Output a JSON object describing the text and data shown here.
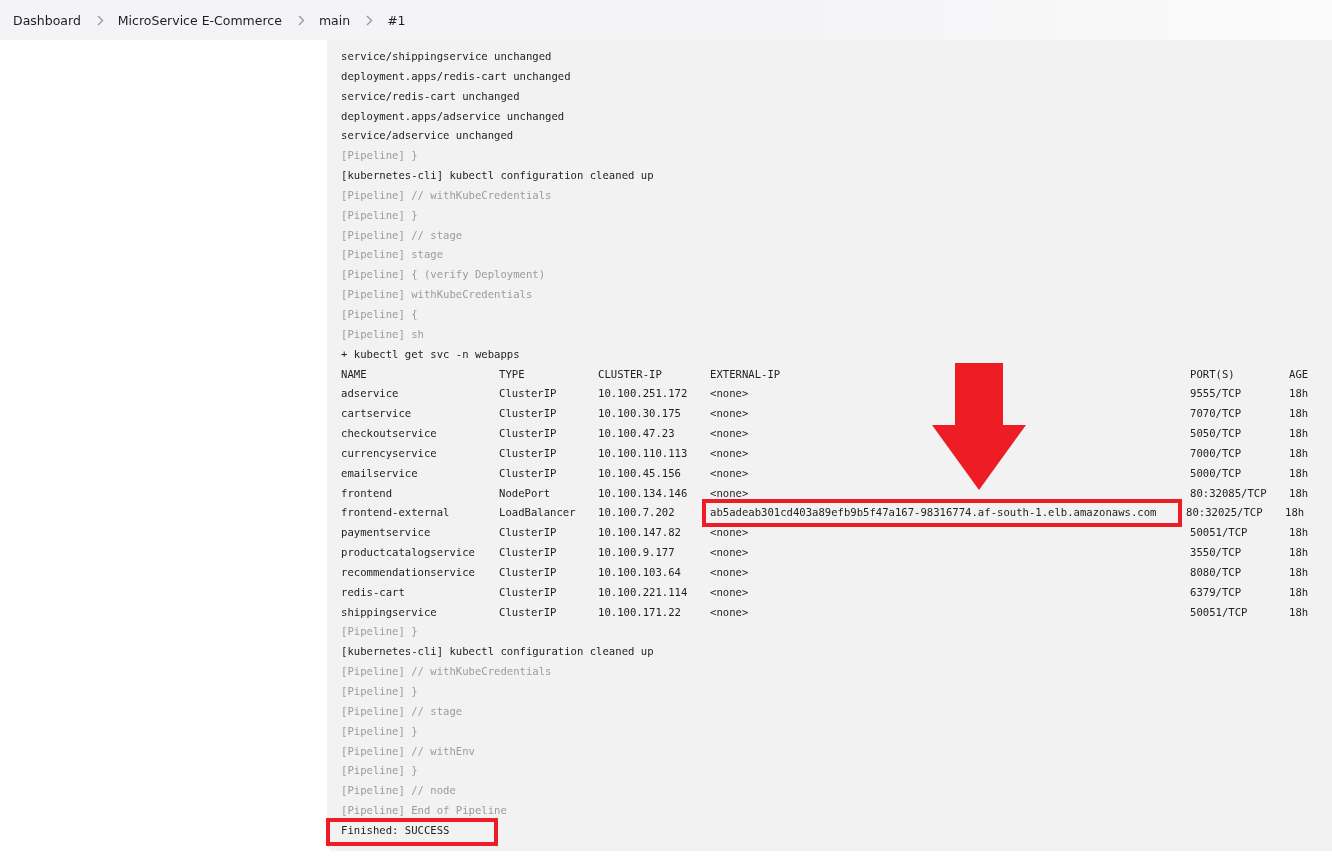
{
  "breadcrumb": [
    {
      "label": "Dashboard"
    },
    {
      "label": "MicroService E-Commerce"
    },
    {
      "label": "main"
    },
    {
      "label": "#1"
    }
  ],
  "log_before": [
    {
      "text": "service/shippingservice unchanged",
      "kind": "output"
    },
    {
      "text": "deployment.apps/redis-cart unchanged",
      "kind": "output"
    },
    {
      "text": "service/redis-cart unchanged",
      "kind": "output"
    },
    {
      "text": "deployment.apps/adservice unchanged",
      "kind": "output"
    },
    {
      "text": "service/adservice unchanged",
      "kind": "output"
    },
    {
      "text": "[Pipeline] }",
      "kind": "step"
    },
    {
      "text": "[kubernetes-cli] kubectl configuration cleaned up",
      "kind": "output"
    },
    {
      "text": "[Pipeline] // withKubeCredentials",
      "kind": "step"
    },
    {
      "text": "[Pipeline] }",
      "kind": "step"
    },
    {
      "text": "[Pipeline] // stage",
      "kind": "step"
    },
    {
      "text": "[Pipeline] stage",
      "kind": "step"
    },
    {
      "text": "[Pipeline] { (verify Deployment)",
      "kind": "step"
    },
    {
      "text": "[Pipeline] withKubeCredentials",
      "kind": "step"
    },
    {
      "text": "[Pipeline] {",
      "kind": "step"
    },
    {
      "text": "[Pipeline] sh",
      "kind": "step"
    },
    {
      "text": "+ kubectl get svc -n webapps",
      "kind": "output"
    }
  ],
  "svc_table": {
    "columns": [
      "NAME",
      "TYPE",
      "CLUSTER-IP",
      "EXTERNAL-IP",
      "PORT(S)",
      "AGE"
    ],
    "rows": [
      {
        "cells": [
          "adservice",
          "ClusterIP",
          "10.100.251.172",
          "<none>",
          "9555/TCP",
          "18h"
        ],
        "highlighted": false
      },
      {
        "cells": [
          "cartservice",
          "ClusterIP",
          "10.100.30.175",
          "<none>",
          "7070/TCP",
          "18h"
        ],
        "highlighted": false
      },
      {
        "cells": [
          "checkoutservice",
          "ClusterIP",
          "10.100.47.23",
          "<none>",
          "5050/TCP",
          "18h"
        ],
        "highlighted": false
      },
      {
        "cells": [
          "currencyservice",
          "ClusterIP",
          "10.100.110.113",
          "<none>",
          "7000/TCP",
          "18h"
        ],
        "highlighted": false
      },
      {
        "cells": [
          "emailservice",
          "ClusterIP",
          "10.100.45.156",
          "<none>",
          "5000/TCP",
          "18h"
        ],
        "highlighted": false
      },
      {
        "cells": [
          "frontend",
          "NodePort",
          "10.100.134.146",
          "<none>",
          "80:32085/TCP",
          "18h"
        ],
        "highlighted": false
      },
      {
        "cells": [
          "frontend-external",
          "LoadBalancer",
          "10.100.7.202",
          "ab5adeab301cd403a89efb9b5f47a167-98316774.af-south-1.elb.amazonaws.com",
          "80:32025/TCP",
          "18h"
        ],
        "highlighted": true
      },
      {
        "cells": [
          "paymentservice",
          "ClusterIP",
          "10.100.147.82",
          "<none>",
          "50051/TCP",
          "18h"
        ],
        "highlighted": false
      },
      {
        "cells": [
          "productcatalogservice",
          "ClusterIP",
          "10.100.9.177",
          "<none>",
          "3550/TCP",
          "18h"
        ],
        "highlighted": false
      },
      {
        "cells": [
          "recommendationservice",
          "ClusterIP",
          "10.100.103.64",
          "<none>",
          "8080/TCP",
          "18h"
        ],
        "highlighted": false
      },
      {
        "cells": [
          "redis-cart",
          "ClusterIP",
          "10.100.221.114",
          "<none>",
          "6379/TCP",
          "18h"
        ],
        "highlighted": false
      },
      {
        "cells": [
          "shippingservice",
          "ClusterIP",
          "10.100.171.22",
          "<none>",
          "50051/TCP",
          "18h"
        ],
        "highlighted": false
      }
    ]
  },
  "log_after": [
    {
      "text": "[Pipeline] }",
      "kind": "step",
      "highlighted": false
    },
    {
      "text": "[kubernetes-cli] kubectl configuration cleaned up",
      "kind": "output",
      "highlighted": false
    },
    {
      "text": "[Pipeline] // withKubeCredentials",
      "kind": "step",
      "highlighted": false
    },
    {
      "text": "[Pipeline] }",
      "kind": "step",
      "highlighted": false
    },
    {
      "text": "[Pipeline] // stage",
      "kind": "step",
      "highlighted": false
    },
    {
      "text": "[Pipeline] }",
      "kind": "step",
      "highlighted": false
    },
    {
      "text": "[Pipeline] // withEnv",
      "kind": "step",
      "highlighted": false
    },
    {
      "text": "[Pipeline] }",
      "kind": "step",
      "highlighted": false
    },
    {
      "text": "[Pipeline] // node",
      "kind": "step",
      "highlighted": false
    },
    {
      "text": "[Pipeline] End of Pipeline",
      "kind": "step",
      "highlighted": false
    },
    {
      "text": "Finished: SUCCESS",
      "kind": "output",
      "highlighted": true
    }
  ]
}
